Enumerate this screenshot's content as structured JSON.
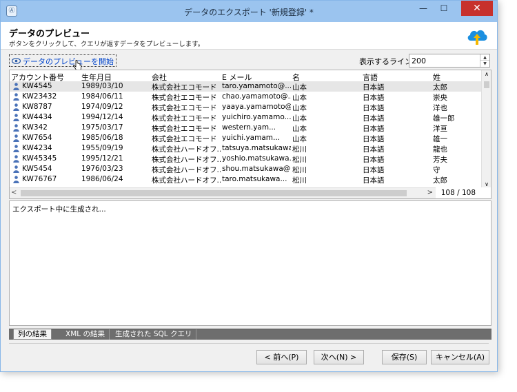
{
  "window": {
    "title": "データのエクスポート '新規登録' *",
    "app_icon_glyph": "Ⓐ",
    "minimize_glyph": "—",
    "maximize_glyph": "☐",
    "close_glyph": "✕"
  },
  "header": {
    "title": "データのプレビュー",
    "description": "ボタンをクリックして、クエリが返すデータをプレビューします。",
    "icon": "cloud-upload-icon",
    "icon_color": "#1b8fe0",
    "arrow_color": "#f5b800"
  },
  "preview": {
    "link_label": "データのプレビューを開始",
    "link_color": "#0044cc"
  },
  "lines": {
    "label": "表示するライン:",
    "value": "200",
    "up_glyph": "▲",
    "down_glyph": "▼"
  },
  "grid": {
    "columns": [
      "アカウント番号",
      "生年月日",
      "会社",
      "E メール",
      "名",
      "言語",
      "姓"
    ],
    "rows": [
      [
        "KW4545",
        "1989/03/10",
        "株式会社エコモード",
        "taro.yamamoto@...",
        "山本",
        "日本語",
        "太郎"
      ],
      [
        "KW23432",
        "1984/06/11",
        "株式会社エコモード",
        "chao.yamamoto@...",
        "山本",
        "日本語",
        "崇央"
      ],
      [
        "KW8787",
        "1974/09/12",
        "株式会社エコモード",
        "yaaya.yamamoto@...",
        "山本",
        "日本語",
        "洋也"
      ],
      [
        "KW4434",
        "1994/12/14",
        "株式会社エコモード",
        "yuichiro.yamamo...",
        "山本",
        "日本語",
        "雄一郎"
      ],
      [
        "KW342",
        "1975/03/17",
        "株式会社エコモード",
        "western.yam...",
        "山本",
        "日本語",
        "洋亘"
      ],
      [
        "KW7654",
        "1985/06/18",
        "株式会社エコモード",
        "yuichi.yamam...",
        "山本",
        "日本語",
        "雄一"
      ],
      [
        "KW4234",
        "1955/09/19",
        "株式会社ハードオフ...",
        "tatsuya.matsukawa...",
        "松川",
        "日本語",
        "龍也"
      ],
      [
        "KW45345",
        "1995/12/21",
        "株式会社ハードオフ...",
        "yoshio.matsukawa...",
        "松川",
        "日本語",
        "芳夫"
      ],
      [
        "KW5454",
        "1976/03/23",
        "株式会社ハードオフ...",
        "shou.matsukawa@...",
        "松川",
        "日本語",
        "守"
      ],
      [
        "KW76767",
        "1986/06/24",
        "株式会社ハードオフ...",
        "taro.matsukawa...",
        "松川",
        "日本語",
        "太郎"
      ]
    ],
    "row_count": "108 / 108",
    "scroll_left_glyph": "<",
    "scroll_right_glyph": ">",
    "scroll_up_glyph": "∧",
    "scroll_down_glyph": "∨"
  },
  "output": {
    "text": "エクスポート中に生成され..."
  },
  "tabs": [
    {
      "label": "列の結果",
      "active": true
    },
    {
      "label": "XML の結果",
      "active": false
    },
    {
      "label": "生成された SQL クエリ",
      "active": false
    }
  ],
  "buttons": {
    "prev": "< 前へ(P)",
    "next": "次へ(N) >",
    "save": "保存(S)",
    "cancel": "キャンセル(A)"
  }
}
